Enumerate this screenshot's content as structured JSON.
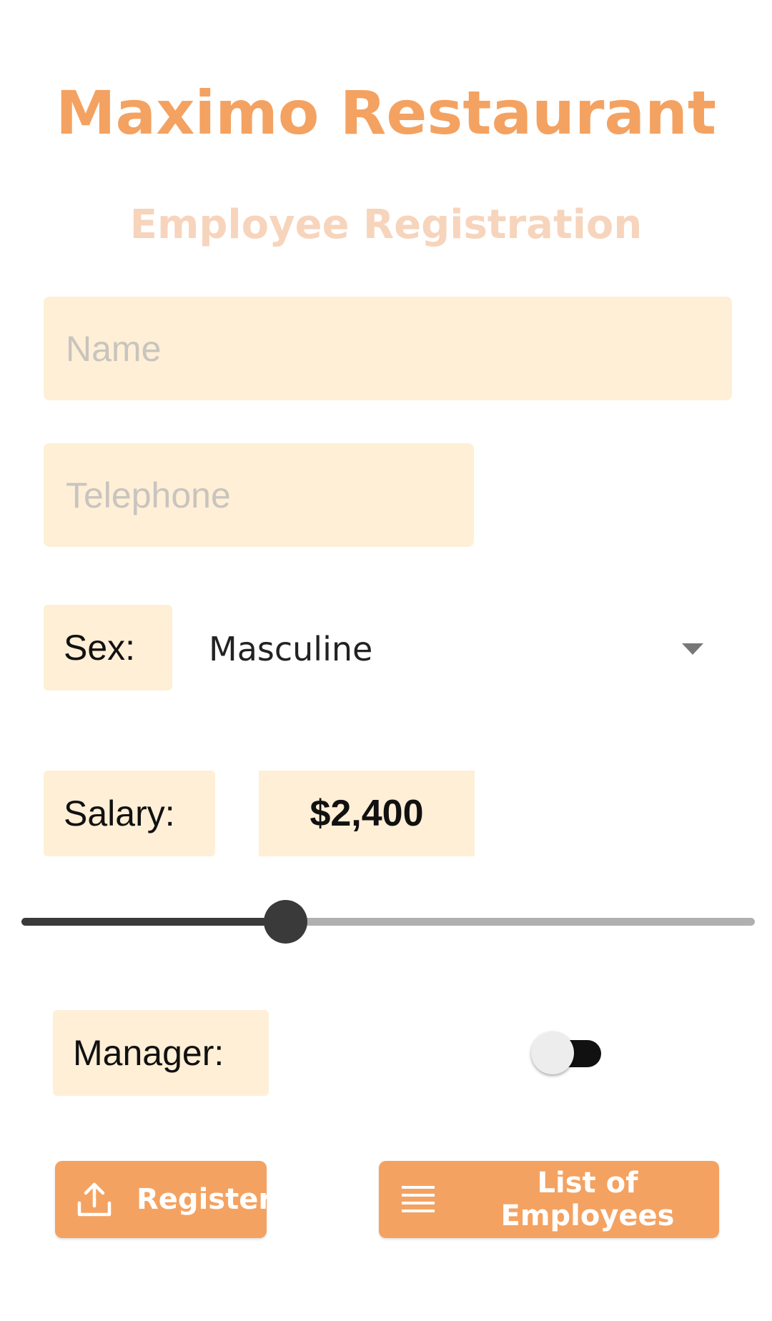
{
  "header": {
    "title": "Maximo Restaurant",
    "subtitle": "Employee Registration"
  },
  "form": {
    "name": {
      "placeholder": "Name",
      "value": ""
    },
    "telephone": {
      "placeholder": "Telephone",
      "value": ""
    },
    "sex": {
      "label": "Sex:",
      "selected": "Masculine"
    },
    "salary": {
      "label": "Salary:",
      "value_text": "$2,400",
      "slider_fraction": 0.36
    },
    "manager": {
      "label": "Manager:",
      "enabled": false
    }
  },
  "actions": {
    "register_label": "Register",
    "register_icon": "upload-icon",
    "list_label": "List of Employees",
    "list_icon": "list-icon"
  },
  "colors": {
    "accent": "#F4A261",
    "subtitle": "#F7D4BC",
    "field_bg": "#FEEFD6",
    "slider_active": "#3A3A3A",
    "slider_inactive": "#B0B0B0"
  }
}
